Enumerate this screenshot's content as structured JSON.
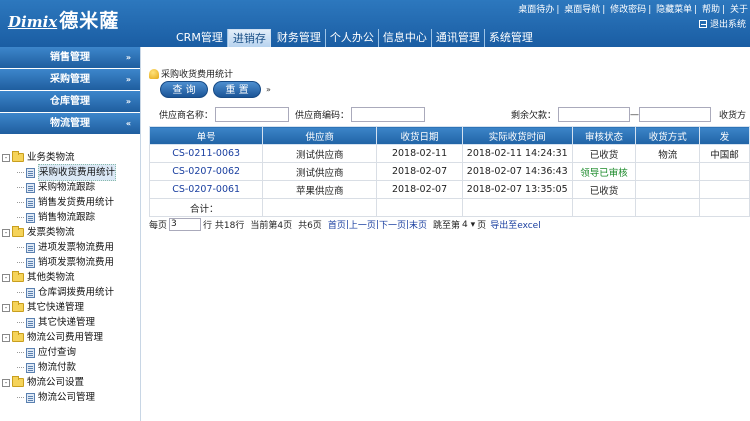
{
  "header": {
    "logo_en": "Dimix",
    "logo_cn": "德米薩",
    "top_links": [
      "桌面待办",
      "桌面导航",
      "修改密码",
      "隐藏菜单",
      "帮助",
      "关于"
    ],
    "logout": "退出系统",
    "nav_tabs": [
      "CRM管理",
      "进销存",
      "财务管理",
      "个人办公",
      "信息中心",
      "通讯管理",
      "系统管理"
    ],
    "active_tab": "进销存"
  },
  "sidebar": {
    "sections": [
      {
        "label": "销售管理",
        "chev": "»"
      },
      {
        "label": "采购管理",
        "chev": "»"
      },
      {
        "label": "仓库管理",
        "chev": "»"
      },
      {
        "label": "物流管理",
        "chev": "«"
      }
    ],
    "tree": [
      {
        "label": "业务类物流",
        "type": "folder",
        "exp": "-"
      },
      {
        "label": "采购收货费用统计",
        "type": "leaf",
        "selected": true
      },
      {
        "label": "采购物流跟踪",
        "type": "leaf"
      },
      {
        "label": "销售发货费用统计",
        "type": "leaf"
      },
      {
        "label": "销售物流跟踪",
        "type": "leaf"
      },
      {
        "label": "发票类物流",
        "type": "folder",
        "exp": "-"
      },
      {
        "label": "进项发票物流费用",
        "type": "leaf"
      },
      {
        "label": "销项发票物流费用",
        "type": "leaf"
      },
      {
        "label": "其他类物流",
        "type": "folder",
        "exp": "-"
      },
      {
        "label": "仓库调拨费用统计",
        "type": "leaf"
      },
      {
        "label": "其它快递管理",
        "type": "folder",
        "exp": "-"
      },
      {
        "label": "其它快递管理",
        "type": "leaf"
      },
      {
        "label": "物流公司费用管理",
        "type": "folder",
        "exp": "-"
      },
      {
        "label": "应付查询",
        "type": "leaf"
      },
      {
        "label": "物流付款",
        "type": "leaf"
      },
      {
        "label": "物流公司设置",
        "type": "folder",
        "exp": "-"
      },
      {
        "label": "物流公司管理",
        "type": "leaf"
      }
    ]
  },
  "main": {
    "title": "采购收货费用统计",
    "query_btn": "查 询",
    "reset_btn": "重 置",
    "more_icon": "»",
    "filters": {
      "supplier_name": "供应商名称：",
      "supplier_code": "供应商编码：",
      "remain_debt": "剩余欠款：",
      "dash": "—",
      "receive_method": "收货方"
    },
    "table": {
      "headers": [
        "单号",
        "供应商",
        "收货日期",
        "实际收货时间",
        "审核状态",
        "收货方式",
        "发"
      ],
      "rows": [
        {
          "id": "CS-0211-0063",
          "supplier": "测试供应商",
          "date": "2018-02-11",
          "actual": "2018-02-11 14:24:31",
          "status": "已收货",
          "method": "物流",
          "extra": "中国邮"
        },
        {
          "id": "CS-0207-0062",
          "supplier": "测试供应商",
          "date": "2018-02-07",
          "actual": "2018-02-07 14:36:43",
          "status": "领导已审核",
          "method": "",
          "extra": ""
        },
        {
          "id": "CS-0207-0061",
          "supplier": "苹果供应商",
          "date": "2018-02-07",
          "actual": "2018-02-07 13:35:05",
          "status": "已收货",
          "method": "",
          "extra": ""
        }
      ],
      "sum_label": "合计："
    },
    "pager": {
      "per_page_label": "每页",
      "per_page_value": "3",
      "row_total": "行 共18行",
      "current": "当前第4页",
      "total_pages": "共6页",
      "first": "首页",
      "prev": "上一页",
      "next": "下一页",
      "last": "末页",
      "jump_label": "跳至第",
      "jump_value": "4",
      "page_unit": "页",
      "export": "导出至excel"
    }
  }
}
